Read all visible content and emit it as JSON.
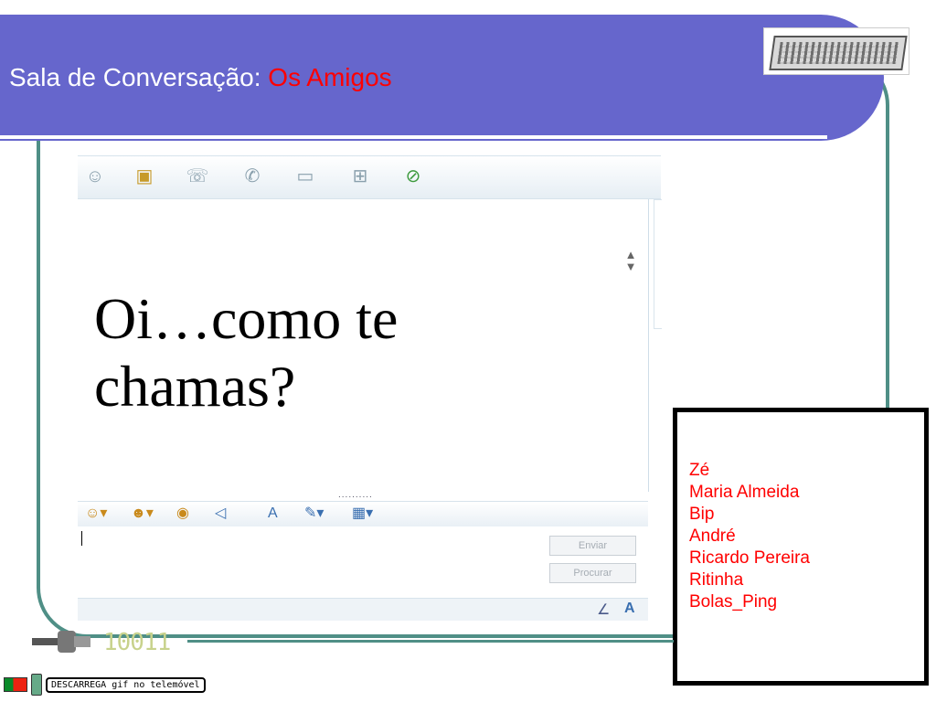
{
  "header": {
    "title_prefix": "Sala de Conversação:",
    "title_highlight": "Os Amigos"
  },
  "chat": {
    "message_line1": "Oi…como te",
    "message_line2": "chamas?",
    "divider": "..........",
    "send_button": "Enviar",
    "search_button": "Procurar"
  },
  "toolbar_icons": [
    "add-contact-icon",
    "share-files-icon",
    "call-icon",
    "phone-icon",
    "video-icon",
    "activities-icon",
    "block-icon"
  ],
  "format_icons": [
    "emoticon-icon",
    "wink-icon",
    "nudge-icon",
    "voice-clip-icon",
    "font-icon",
    "background-icon",
    "theme-icon"
  ],
  "users": [
    "Zé",
    "Maria Almeida",
    "Bip",
    "André",
    "Ricardo Pereira",
    "Ritinha",
    "Bolas_Ping"
  ],
  "badge": {
    "text": "DESCARREGA gif no telemóvel"
  },
  "logo": {
    "digits": "10011"
  },
  "colors": {
    "header_bg": "#6666cc",
    "frame": "#4f8f86",
    "highlight": "#ff0000"
  }
}
